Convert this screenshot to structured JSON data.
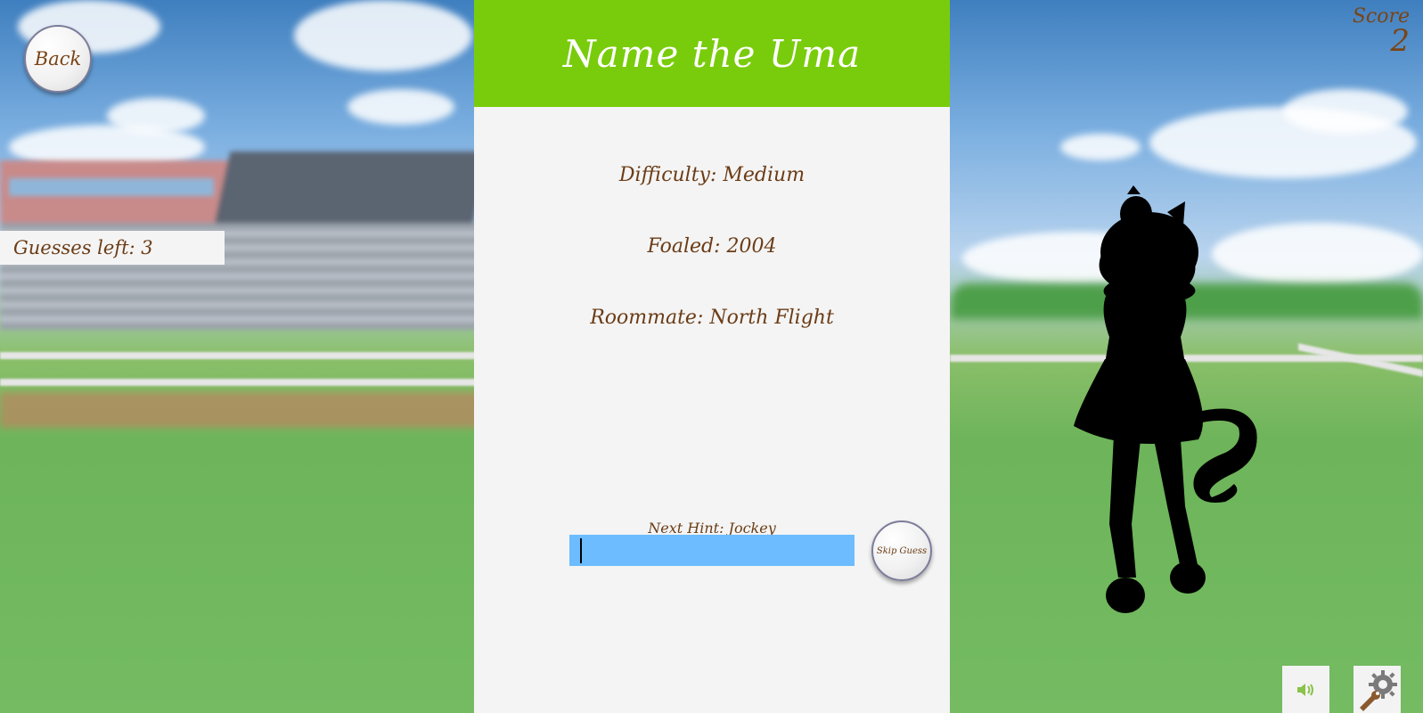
{
  "header": {
    "title": "Name the Uma"
  },
  "back_button": {
    "label": "Back"
  },
  "guesses": {
    "text": "Guesses left: 3"
  },
  "score": {
    "label": "Score",
    "value": "2"
  },
  "hints": [
    "Difficulty: Medium",
    "Foaled: 2004",
    "Roommate: North Flight"
  ],
  "next_hint": "Next Hint: Jockey",
  "guess_input": {
    "value": "",
    "placeholder": ""
  },
  "skip_button": {
    "label": "Skip Guess"
  },
  "icons": {
    "sound": "speaker-icon",
    "settings": "gear-wrench-icon"
  },
  "colors": {
    "header_green": "#79cc0b",
    "input_blue": "#6cbcff",
    "text_brown": "#6b3c16",
    "panel_bg": "#f4f4f4"
  }
}
